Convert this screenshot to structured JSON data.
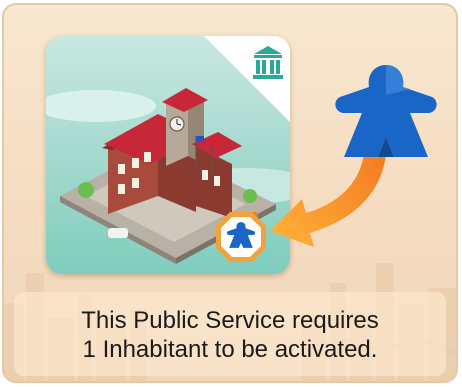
{
  "caption": {
    "line1": "This Public Service requires",
    "line2": "1 Inhabitant to be activated."
  },
  "card": {
    "category_icon": "public-service-columns-icon",
    "cost_icon": "blue-meeple-icon",
    "cost": 1
  },
  "icons": {
    "token": "blue-meeple-icon",
    "arrow": "curved-arrow-icon"
  },
  "colors": {
    "meeple": "#1a66c6",
    "arrow": "#f7931e",
    "card_teal": "#2aa99a",
    "badge_ring": "#f2a23a"
  }
}
